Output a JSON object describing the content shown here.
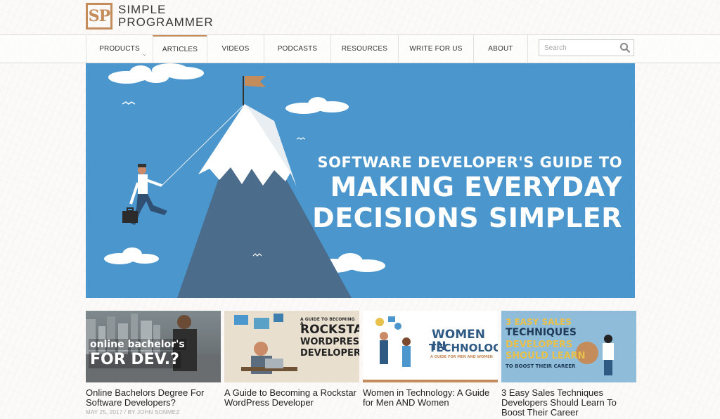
{
  "brand": {
    "mark": "SP",
    "line1": "SIMPLE",
    "line2": "PROGRAMMER",
    "color": "#c48b5b"
  },
  "nav": {
    "items": [
      {
        "label": "PRODUCTS",
        "has_caret": true
      },
      {
        "label": "ARTICLES",
        "active": true
      },
      {
        "label": "VIDEOS"
      },
      {
        "label": "PODCASTS"
      },
      {
        "label": "RESOURCES"
      },
      {
        "label": "WRITE FOR US"
      },
      {
        "label": "ABOUT"
      }
    ],
    "search_placeholder": "Search",
    "search_icon": "search-icon"
  },
  "hero": {
    "line1": "SOFTWARE DEVELOPER'S GUIDE TO",
    "line2": "MAKING EVERYDAY",
    "line3": "DECISIONS SIMPLER",
    "bg": "#4a96cd"
  },
  "articles": [
    {
      "title": "Online Bachelors Degree For Software Developers?",
      "meta": "MAY 25, 2017 / BY JOHN SONMEZ",
      "thumb_text": [
        "online bachelor's",
        "FOR DEV.?"
      ]
    },
    {
      "title": "A Guide to Becoming a Rockstar WordPress Developer",
      "thumb_text": [
        "A GUIDE TO BECOMING A",
        "ROCKSTAR",
        "WORDPRESS",
        "DEVELOPER"
      ]
    },
    {
      "title": "Women in Technology: A Guide for Men AND Women",
      "thumb_text": [
        "WOMEN IN",
        "TECHNOLOGY",
        "A GUIDE FOR MEN AND WOMEN"
      ]
    },
    {
      "title": "3 Easy Sales Techniques Developers Should Learn To Boost Their Career",
      "thumb_text": [
        "3 EASY SALES",
        "TECHNIQUES",
        "DEVELOPERS",
        "SHOULD LEARN",
        "TO BOOST THEIR CAREER"
      ]
    }
  ]
}
